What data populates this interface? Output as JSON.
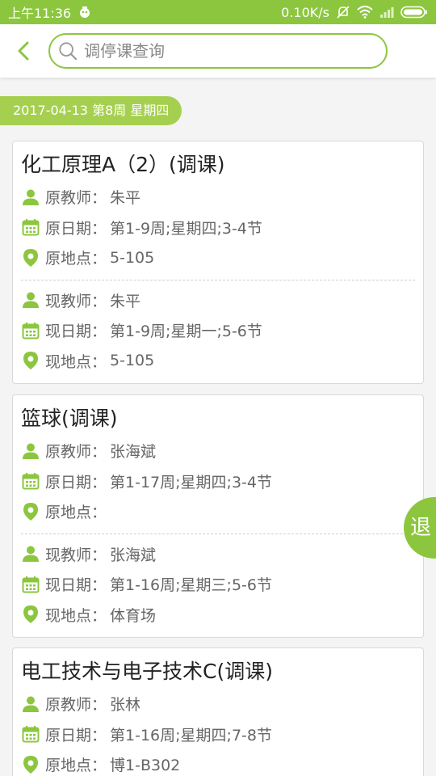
{
  "status": {
    "time": "上午11:36",
    "speed": "0.10K/s"
  },
  "search": {
    "placeholder": "调停课查询"
  },
  "date_tag": "2017-04-13 第8周 星期四",
  "labels": {
    "orig_teacher": "原教师：",
    "orig_date": "原日期：",
    "orig_place": "原地点：",
    "new_teacher": "现教师：",
    "new_date": "现日期：",
    "new_place": "现地点："
  },
  "courses": [
    {
      "title": "化工原理A（2）(调课)",
      "orig_teacher": "朱平",
      "orig_date": "第1-9周;星期四;3-4节",
      "orig_place": "5-105",
      "new_teacher": "朱平",
      "new_date": "第1-9周;星期一;5-6节",
      "new_place": "5-105"
    },
    {
      "title": "篮球(调课)",
      "orig_teacher": "张海斌",
      "orig_date": "第1-17周;星期四;3-4节",
      "orig_place": "",
      "new_teacher": "张海斌",
      "new_date": "第1-16周;星期三;5-6节",
      "new_place": "体育场"
    },
    {
      "title": "电工技术与电子技术C(调课)",
      "orig_teacher": "张林",
      "orig_date": "第1-16周;星期四;7-8节",
      "orig_place": "博1-B302"
    }
  ],
  "exit_label": "退",
  "colors": {
    "accent": "#8cc63f",
    "tag": "#a5d04f"
  }
}
